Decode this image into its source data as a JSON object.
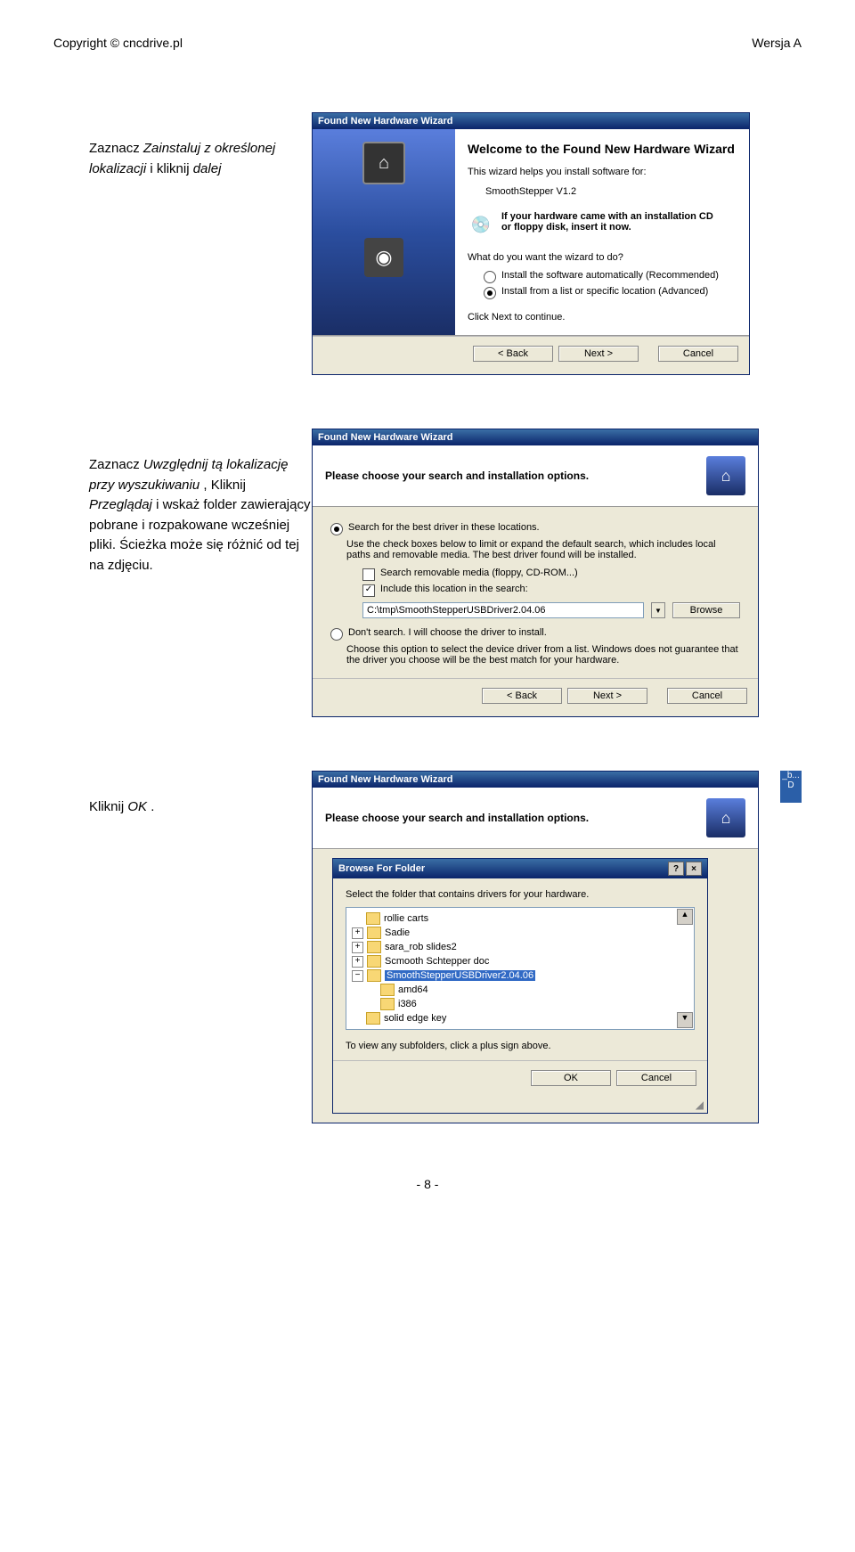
{
  "header": {
    "copyright": "Copyright © cncdrive.pl",
    "version": "Wersja A"
  },
  "instr1": {
    "line1a": "Zaznacz ",
    "line1b": "Zainstaluj z określonej lokalizacji",
    "line2a": " i kliknij ",
    "line2b": "dalej"
  },
  "wizard1": {
    "title": "Found New Hardware Wizard",
    "welcome": "Welcome to the Found New Hardware Wizard",
    "helps": "This wizard helps you install software for:",
    "device": "SmoothStepper V1.2",
    "cd1": "If your hardware came with an installation CD",
    "cd2": "or floppy disk, insert it now.",
    "q": "What do you want the wizard to do?",
    "opt1": "Install the software automatically (Recommended)",
    "opt2": "Install from a list or specific location (Advanced)",
    "next_hint": "Click Next to continue.",
    "back": "< Back",
    "next": "Next >",
    "cancel": "Cancel"
  },
  "instr2": {
    "t1": "Zaznacz ",
    "t2": "Uwzględnij tą lokalizację przy wyszukiwaniu",
    "t3": ", Kliknij ",
    "t4": "Przeglądaj",
    "t5": " i wskaż folder zawierający pobrane i rozpakowane wcześniej pliki. Ścieżka może się różnić od tej na zdjęciu."
  },
  "wizard2": {
    "title": "Found New Hardware Wizard",
    "header": "Please choose your search and installation options.",
    "opt_search": "Search for the best driver in these locations.",
    "search_help": "Use the check boxes below to limit or expand the default search, which includes local paths and removable media. The best driver found will be installed.",
    "chk_removable": "Search removable media (floppy, CD-ROM...)",
    "chk_include": "Include this location in the search:",
    "path": "C:\\tmp\\SmoothStepperUSBDriver2.04.06",
    "browse": "Browse",
    "opt_dont": "Don't search. I will choose the driver to install.",
    "dont_help": "Choose this option to select the device driver from a list. Windows does not guarantee that the driver you choose will be the best match for your hardware.",
    "back": "< Back",
    "next": "Next >",
    "cancel": "Cancel"
  },
  "instr3": {
    "t1": "Kliknij ",
    "t2": "OK",
    "t3": "."
  },
  "wizard3": {
    "title": "Found New Hardware Wizard",
    "header": "Please choose your search and installation options.",
    "browse_title": "Browse For Folder",
    "browse_msg": "Select the folder that contains drivers for your hardware.",
    "folders": {
      "f1": "rollie carts",
      "f2": "Sadie",
      "f3": "sara_rob slides2",
      "f4": "Scmooth Schtepper doc",
      "f5": "SmoothStepperUSBDriver2.04.06",
      "f6": "amd64",
      "f7": "i386",
      "f8": "solid edge key"
    },
    "subfolder_hint": "To view any subfolders, click a plus sign above.",
    "ok": "OK",
    "cancel": "Cancel",
    "behind_b": "_b...",
    "behind_d": "D"
  },
  "page_num": "- 8 -"
}
